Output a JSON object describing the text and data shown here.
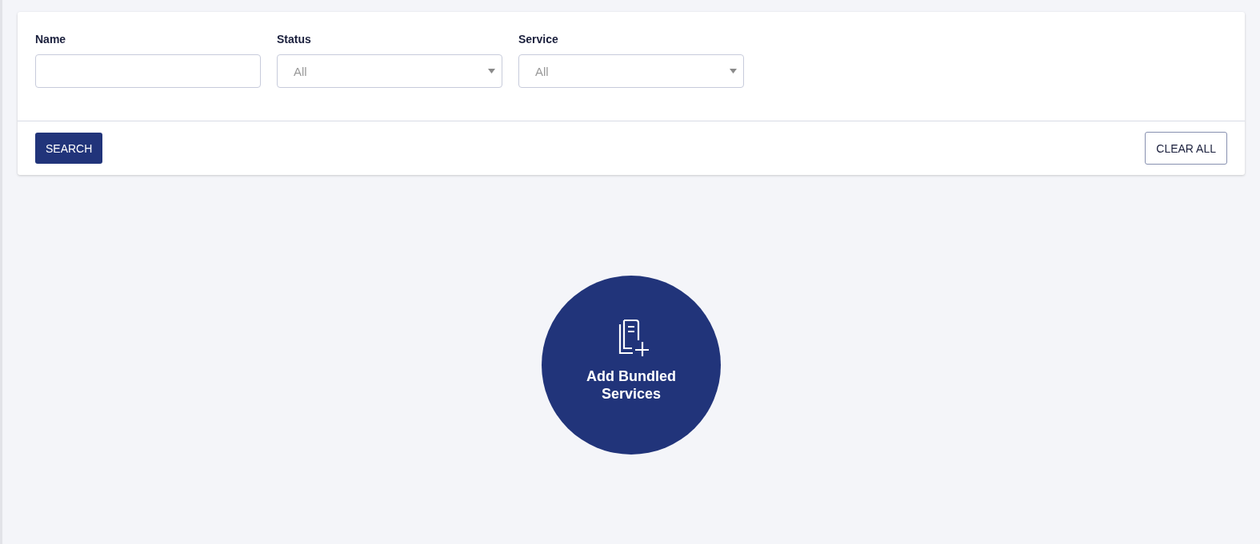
{
  "filters": [
    {
      "label": "Name",
      "kind": "text"
    },
    {
      "label": "Status",
      "kind": "select",
      "value": "All"
    },
    {
      "label": "Service",
      "kind": "select",
      "value": "All"
    }
  ],
  "actions": {
    "search": "SEARCH",
    "clear": "CLEAR ALL"
  },
  "add_button": {
    "label": "Add Bundled Services"
  }
}
